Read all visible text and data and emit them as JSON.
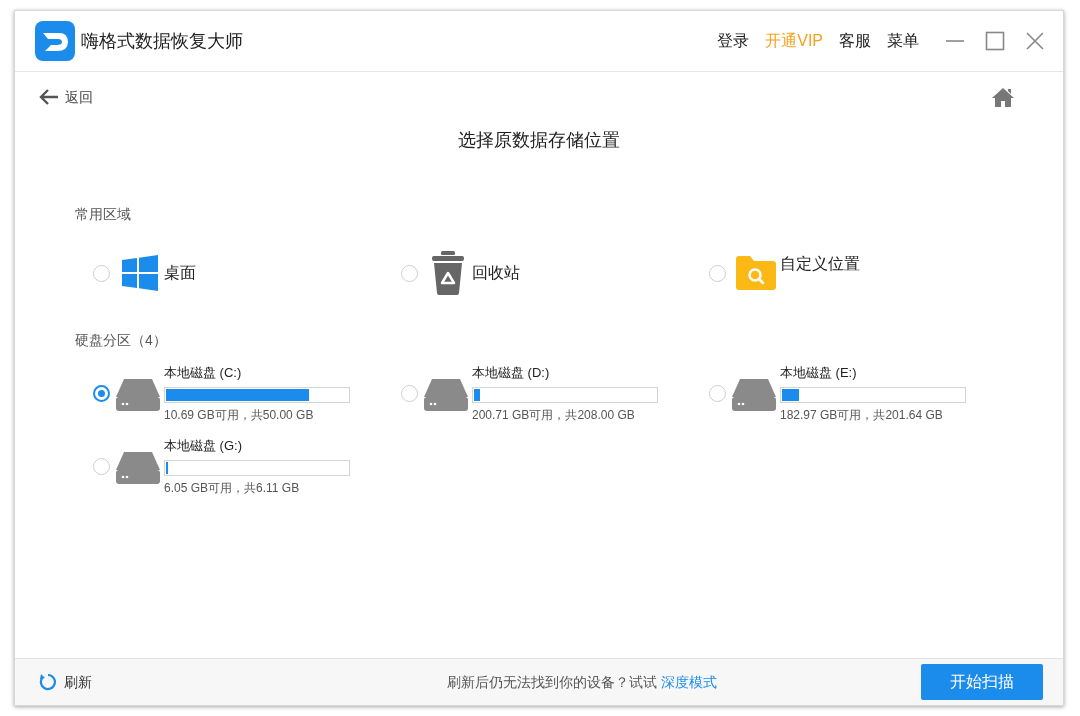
{
  "window": {
    "title": "嗨格式数据恢复大师"
  },
  "header_links": [
    {
      "label": "登录",
      "highlight": false
    },
    {
      "label": "开通VIP",
      "highlight": true
    },
    {
      "label": "客服",
      "highlight": false
    },
    {
      "label": "菜单",
      "highlight": false
    }
  ],
  "back": {
    "label": "返回"
  },
  "heading": "选择原数据存储位置",
  "common": {
    "label": "常用区域",
    "items": [
      {
        "kind": "windows",
        "label": "桌面",
        "selected": false
      },
      {
        "kind": "trash",
        "label": "回收站",
        "selected": false
      },
      {
        "kind": "folder",
        "label": "自定义位置",
        "selected": false
      }
    ]
  },
  "disks": {
    "label": "硬盘分区（4）",
    "items": [
      {
        "name": "本地磁盘 (C:)",
        "level": 0.786,
        "info": "10.69 GB可用，共50.00 GB",
        "selected": true
      },
      {
        "name": "本地磁盘 (D:)",
        "level": 0.035,
        "info": "200.71 GB可用，共208.00 GB",
        "selected": false
      },
      {
        "name": "本地磁盘 (E:)",
        "level": 0.093,
        "info": "182.97 GB可用，共201.64 GB",
        "selected": false
      },
      {
        "name": "本地磁盘 (G:)",
        "level": 0.01,
        "info": "6.05 GB可用，共6.11 GB",
        "selected": false
      }
    ]
  },
  "footer": {
    "refresh": "刷新",
    "hint": "刷新后仍无法找到你的设备？试试",
    "link": "深度模式",
    "button": "开始扫描"
  }
}
